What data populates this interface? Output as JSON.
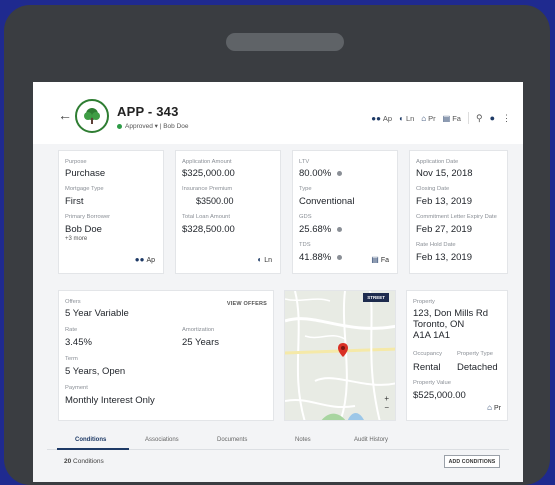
{
  "header": {
    "title": "APP - 343",
    "status": "Approved",
    "owner": "Bob Doe",
    "links": [
      {
        "icon": "people-icon",
        "label": "Ap"
      },
      {
        "icon": "toggle-icon",
        "label": "Ln"
      },
      {
        "icon": "home-icon",
        "label": "Pr"
      },
      {
        "icon": "chart-icon",
        "label": "Fa"
      }
    ]
  },
  "card1": {
    "purpose_label": "Purpose",
    "purpose": "Purchase",
    "mortgage_type_label": "Mortgage Type",
    "mortgage_type": "First",
    "borrower_label": "Primary Borrower",
    "borrower": "Bob Doe",
    "more": "+3 more",
    "badge": "Ap"
  },
  "card2": {
    "amount_label": "Application Amount",
    "amount": "$325,000.00",
    "premium_label": "Insurance Premium",
    "premium": "$3500.00",
    "total_label": "Total Loan Amount",
    "total": "$328,500.00",
    "badge": "Ln"
  },
  "card3": {
    "ltv_label": "LTV",
    "ltv": "80.00%",
    "type_label": "Type",
    "type": "Conventional",
    "gds_label": "GDS",
    "gds": "25.68%",
    "tds_label": "TDS",
    "tds": "41.88%",
    "badge": "Fa"
  },
  "card4": {
    "app_date_label": "Application Date",
    "app_date": "Nov 15, 2018",
    "closing_label": "Closing Date",
    "closing": "Feb 13, 2019",
    "commitment_label": "Commitment Letter Expiry Date",
    "commitment": "Feb 27, 2019",
    "rate_hold_label": "Rate Hold Date",
    "rate_hold": "Feb 13, 2019"
  },
  "offers": {
    "offers_label": "Offers",
    "offers": "5 Year Variable",
    "view_offers": "VIEW OFFERS",
    "rate_label": "Rate",
    "rate": "3.45%",
    "amort_label": "Amortization",
    "amort": "25 Years",
    "term_label": "Term",
    "term": "5 Years, Open",
    "payment_label": "Payment",
    "payment": "Monthly Interest Only"
  },
  "map": {
    "street_button": "STREET"
  },
  "property": {
    "label": "Property",
    "line1": "123, Don Mills Rd",
    "line2": "Toronto, ON",
    "line3": "A1A 1A1",
    "occupancy_label": "Occupancy",
    "occupancy": "Rental",
    "ptype_label": "Property Type",
    "ptype": "Detached",
    "value_label": "Property Value",
    "value": "$525,000.00",
    "badge": "Pr"
  },
  "tabs": [
    "Conditions",
    "Associations",
    "Documents",
    "Notes",
    "Audit History"
  ],
  "conditions": {
    "count": "20",
    "count_suffix": " Conditions",
    "add_label": "ADD CONDITIONS"
  },
  "colors": {
    "background": "#1f2a8f",
    "accent": "#1e3a66",
    "approved": "#2e9b47"
  }
}
